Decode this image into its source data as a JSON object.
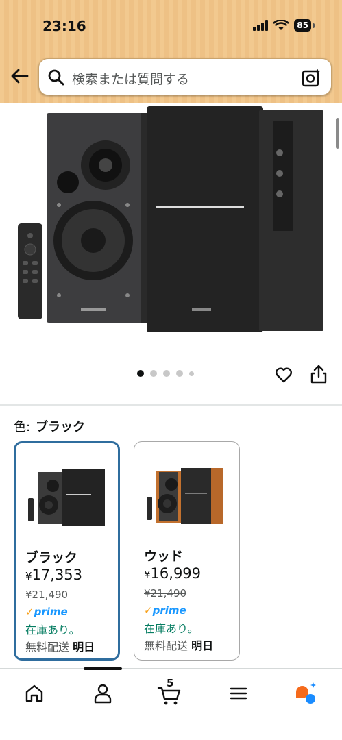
{
  "status_bar": {
    "time": "23:16",
    "battery": "85"
  },
  "search": {
    "placeholder": "検索または質問する"
  },
  "gallery": {
    "image_count": 5,
    "active_index": 0
  },
  "variant": {
    "label": "色:",
    "selected": "ブラック"
  },
  "cards": [
    {
      "name": "ブラック",
      "price_symbol": "¥",
      "price": "17,353",
      "list_price": "¥21,490",
      "prime": "prime",
      "stock": "在庫あり。",
      "ship_prefix": "無料配送",
      "ship_day": "明日"
    },
    {
      "name": "ウッド",
      "price_symbol": "¥",
      "price": "16,999",
      "list_price": "¥21,490",
      "prime": "prime",
      "stock": "在庫あり。",
      "ship_prefix": "無料配送",
      "ship_day": "明日"
    }
  ],
  "bottom_nav": {
    "cart_count": "5"
  },
  "colors": {
    "header": "#f2c98f",
    "selected_border": "#2f6d9e",
    "prime_blue": "#1a98ff",
    "stock_green": "#067d62"
  }
}
